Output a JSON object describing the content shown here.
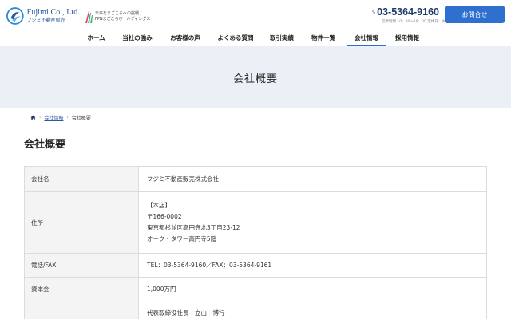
{
  "header": {
    "logo_en": "Fujimi Co., Ltd.",
    "logo_jp": "フジミ不動産販売",
    "group_line1": "未来をまごころへの挑戦 /",
    "group_line2": "FPNまごころホールディングス",
    "phone": "03-5364-9160",
    "phone_hours": "営業時間 10：00〜18：00 定休日：水曜日",
    "contact_label": "お問合せ",
    "nav": [
      {
        "label": "ホーム"
      },
      {
        "label": "当社の強み"
      },
      {
        "label": "お客様の声"
      },
      {
        "label": "よくある質問"
      },
      {
        "label": "取引実績"
      },
      {
        "label": "物件一覧"
      },
      {
        "label": "会社情報",
        "active": true
      },
      {
        "label": "採用情報"
      }
    ]
  },
  "hero": {
    "title": "会社概要"
  },
  "breadcrumb": {
    "items": [
      "会社情報",
      "会社概要"
    ]
  },
  "section": {
    "title": "会社概要"
  },
  "company_table": [
    {
      "label": "会社名",
      "value_lines": [
        "フジミ不動産販売株式会社"
      ]
    },
    {
      "label": "住所",
      "value_lines": [
        "【本店】",
        "〒166-0002",
        "東京都杉並区高円寺北3丁目23-12",
        "オーク・タワー高円寺5階"
      ]
    },
    {
      "label": "電話/FAX",
      "value_lines": [
        "TEL：03-5364-9160／FAX：03-5364-9161"
      ]
    },
    {
      "label": "資本金",
      "value_lines": [
        "1,000万円"
      ]
    },
    {
      "label": "",
      "value_lines": [
        "代表取締役社長　立山　博行"
      ]
    }
  ],
  "colors": {
    "brand_blue": "#2f6fcf",
    "hero_bg": "#eaf0f6",
    "table_header_bg": "#f4f4f4"
  }
}
